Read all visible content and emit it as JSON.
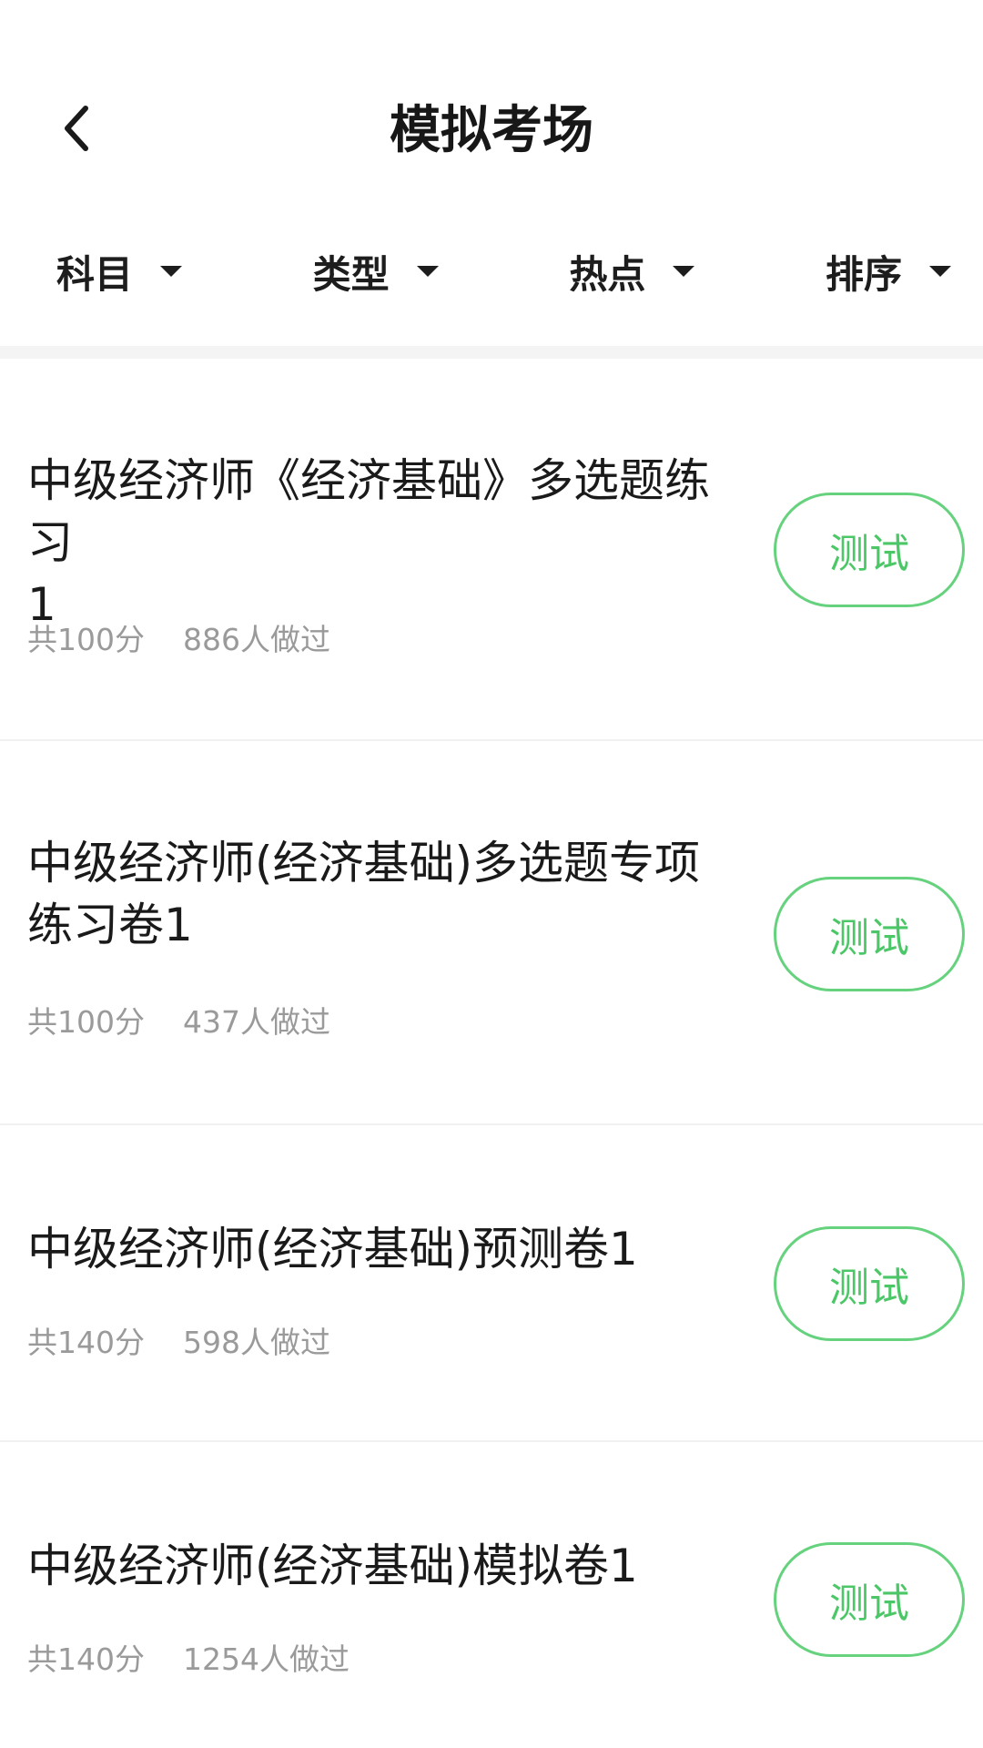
{
  "header": {
    "title": "模拟考场"
  },
  "filters": [
    {
      "label": "科目"
    },
    {
      "label": "类型"
    },
    {
      "label": "热点"
    },
    {
      "label": "排序"
    }
  ],
  "exams": [
    {
      "title_line1": "中级经济师《经济基础》多选题练习",
      "title_line2": "1",
      "score": "共100分",
      "people": "886人做过",
      "button": "测试"
    },
    {
      "title_line1": "中级经济师(经济基础)多选题专项",
      "title_line2": "练习卷1",
      "score": "共100分",
      "people": "437人做过",
      "button": "测试"
    },
    {
      "title_line1": "中级经济师(经济基础)预测卷1",
      "title_line2": "",
      "score": "共140分",
      "people": "598人做过",
      "button": "测试"
    },
    {
      "title_line1": "中级经济师(经济基础)模拟卷1",
      "title_line2": "",
      "score": "共140分",
      "people": "1254人做过",
      "button": "测试"
    }
  ],
  "colors": {
    "accent_green": "#4cc767",
    "meta_gray": "#9a9a9a"
  }
}
